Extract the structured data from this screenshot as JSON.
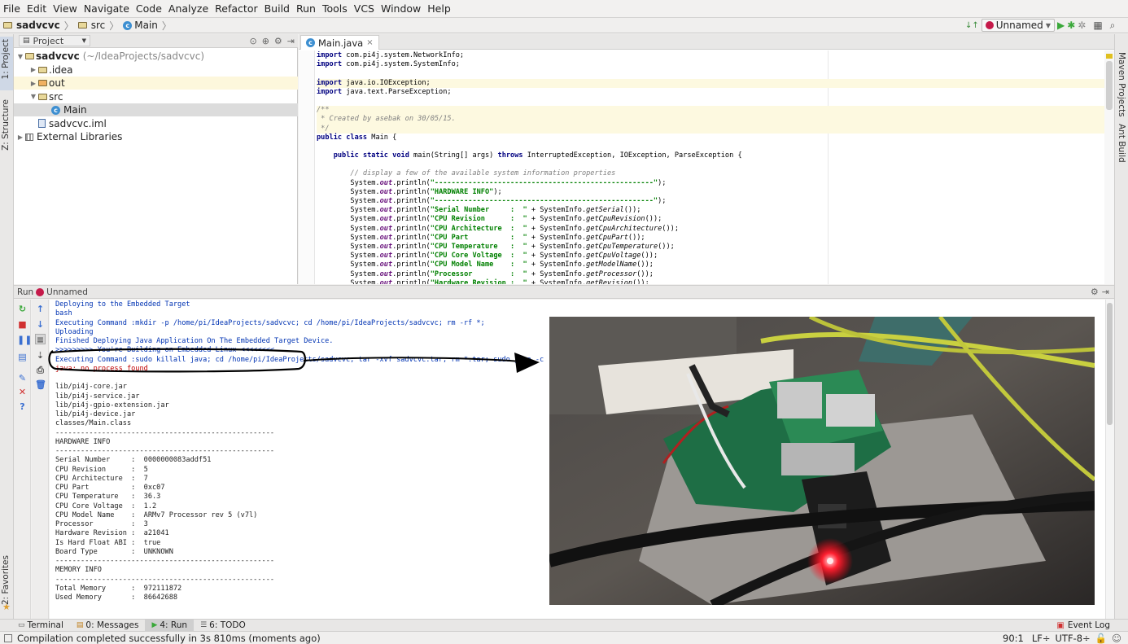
{
  "menu": [
    "File",
    "Edit",
    "View",
    "Navigate",
    "Code",
    "Analyze",
    "Refactor",
    "Build",
    "Run",
    "Tools",
    "VCS",
    "Window",
    "Help"
  ],
  "nav": {
    "project": "sadvcvc",
    "folder": "src",
    "file": "Main",
    "run_config": "Unnamed"
  },
  "left_strip": {
    "project": "1: Project",
    "structure": "Z: Structure",
    "favorites": "2: Favorites"
  },
  "right_strip": {
    "maven": "Maven Projects",
    "ant": "Ant Build"
  },
  "project_panel": {
    "header": "Project",
    "tree": [
      {
        "name": "sadvcvc",
        "hint": "(~/IdeaProjects/sadvcvc)",
        "depth": 0,
        "arrow": "▼",
        "icon": "folder"
      },
      {
        "name": ".idea",
        "depth": 1,
        "arrow": "▶",
        "icon": "folder"
      },
      {
        "name": "out",
        "depth": 1,
        "arrow": "▶",
        "icon": "folder"
      },
      {
        "name": "src",
        "depth": 1,
        "arrow": "▼",
        "icon": "folder"
      },
      {
        "name": "Main",
        "depth": 2,
        "arrow": "",
        "icon": "class"
      },
      {
        "name": "sadvcvc.iml",
        "depth": 1,
        "arrow": "",
        "icon": "file"
      },
      {
        "name": "External Libraries",
        "depth": 0,
        "arrow": "▶",
        "icon": "lib"
      }
    ]
  },
  "editor": {
    "tab": "Main.java"
  },
  "code_lines": [
    "import com.pi4j.system.NetworkInfo;",
    "import com.pi4j.system.SystemInfo;",
    "",
    "import java.io.IOException;",
    "import java.text.ParseException;",
    "",
    "/**",
    " * Created by asebak on 30/05/15.",
    " */",
    "public class Main {",
    "",
    "    public static void main(String[] args) throws InterruptedException, IOException, ParseException {",
    "",
    "        // display a few of the available system information properties",
    "        System.out.println(\"----------------------------------------------------\");",
    "        System.out.println(\"HARDWARE INFO\");",
    "        System.out.println(\"----------------------------------------------------\");",
    "        System.out.println(\"Serial Number     :  \" + SystemInfo.getSerial());",
    "        System.out.println(\"CPU Revision      :  \" + SystemInfo.getCpuRevision());",
    "        System.out.println(\"CPU Architecture  :  \" + SystemInfo.getCpuArchitecture());",
    "        System.out.println(\"CPU Part          :  \" + SystemInfo.getCpuPart());",
    "        System.out.println(\"CPU Temperature   :  \" + SystemInfo.getCpuTemperature());",
    "        System.out.println(\"CPU Core Voltage  :  \" + SystemInfo.getCpuVoltage());",
    "        System.out.println(\"CPU Model Name    :  \" + SystemInfo.getModelName());",
    "        System.out.println(\"Processor         :  \" + SystemInfo.getProcessor());",
    "        System.out.println(\"Hardware Revision :  \" + SystemInfo.getRevision());"
  ],
  "run": {
    "label": "Run",
    "config": "Unnamed"
  },
  "console_lines": [
    {
      "t": "Deploying to the Embedded Target",
      "c": "blue"
    },
    {
      "t": "bash",
      "c": "blue"
    },
    {
      "t": "Executing Command :mkdir -p /home/pi/IdeaProjects/sadvcvc; cd /home/pi/IdeaProjects/sadvcvc; rm -rf *;",
      "c": "blue"
    },
    {
      "t": "Uploading",
      "c": "blue"
    },
    {
      "t": "Finished Deploying Java Application On The Embedded Target Device.",
      "c": "blue"
    },
    {
      "t": ">>>>>>>>> You're Building on Embedded Linux <<<<<<<<",
      "c": "blue"
    },
    {
      "t": "Executing Command :sudo killall java; cd /home/pi/IdeaProjects/sadvcvc; tar -xvf sadvcvc.tar; rm *.tar; sudo java -c",
      "c": "blue"
    },
    {
      "t": "java: no process found",
      "c": "red"
    },
    {
      "t": "",
      "c": ""
    },
    {
      "t": "lib/pi4j-core.jar",
      "c": ""
    },
    {
      "t": "lib/pi4j-service.jar",
      "c": ""
    },
    {
      "t": "lib/pi4j-gpio-extension.jar",
      "c": ""
    },
    {
      "t": "lib/pi4j-device.jar",
      "c": ""
    },
    {
      "t": "classes/Main.class",
      "c": ""
    },
    {
      "t": "----------------------------------------------------",
      "c": ""
    },
    {
      "t": "HARDWARE INFO",
      "c": ""
    },
    {
      "t": "----------------------------------------------------",
      "c": ""
    },
    {
      "t": "Serial Number     :  0000000083addf51",
      "c": ""
    },
    {
      "t": "CPU Revision      :  5",
      "c": ""
    },
    {
      "t": "CPU Architecture  :  7",
      "c": ""
    },
    {
      "t": "CPU Part          :  0xc07",
      "c": ""
    },
    {
      "t": "CPU Temperature   :  36.3",
      "c": ""
    },
    {
      "t": "CPU Core Voltage  :  1.2",
      "c": ""
    },
    {
      "t": "CPU Model Name    :  ARMv7 Processor rev 5 (v7l)",
      "c": ""
    },
    {
      "t": "Processor         :  3",
      "c": ""
    },
    {
      "t": "Hardware Revision :  a21041",
      "c": ""
    },
    {
      "t": "Is Hard Float ABI :  true",
      "c": ""
    },
    {
      "t": "Board Type        :  UNKNOWN",
      "c": ""
    },
    {
      "t": "----------------------------------------------------",
      "c": ""
    },
    {
      "t": "MEMORY INFO",
      "c": ""
    },
    {
      "t": "----------------------------------------------------",
      "c": ""
    },
    {
      "t": "Total Memory      :  972111872",
      "c": ""
    },
    {
      "t": "Used Memory       :  86642688",
      "c": ""
    }
  ],
  "bottom_tabs": [
    {
      "label": "Terminal",
      "icon": "terminal-icon"
    },
    {
      "label": "0: Messages",
      "icon": "messages-icon"
    },
    {
      "label": "4: Run",
      "icon": "run-icon"
    },
    {
      "label": "6: TODO",
      "icon": "todo-icon"
    }
  ],
  "event_log": "Event Log",
  "status": {
    "message": "Compilation completed successfully in 3s 810ms (moments ago)",
    "position": "90:1",
    "line_sep": "LF÷",
    "encoding": "UTF-8÷"
  }
}
